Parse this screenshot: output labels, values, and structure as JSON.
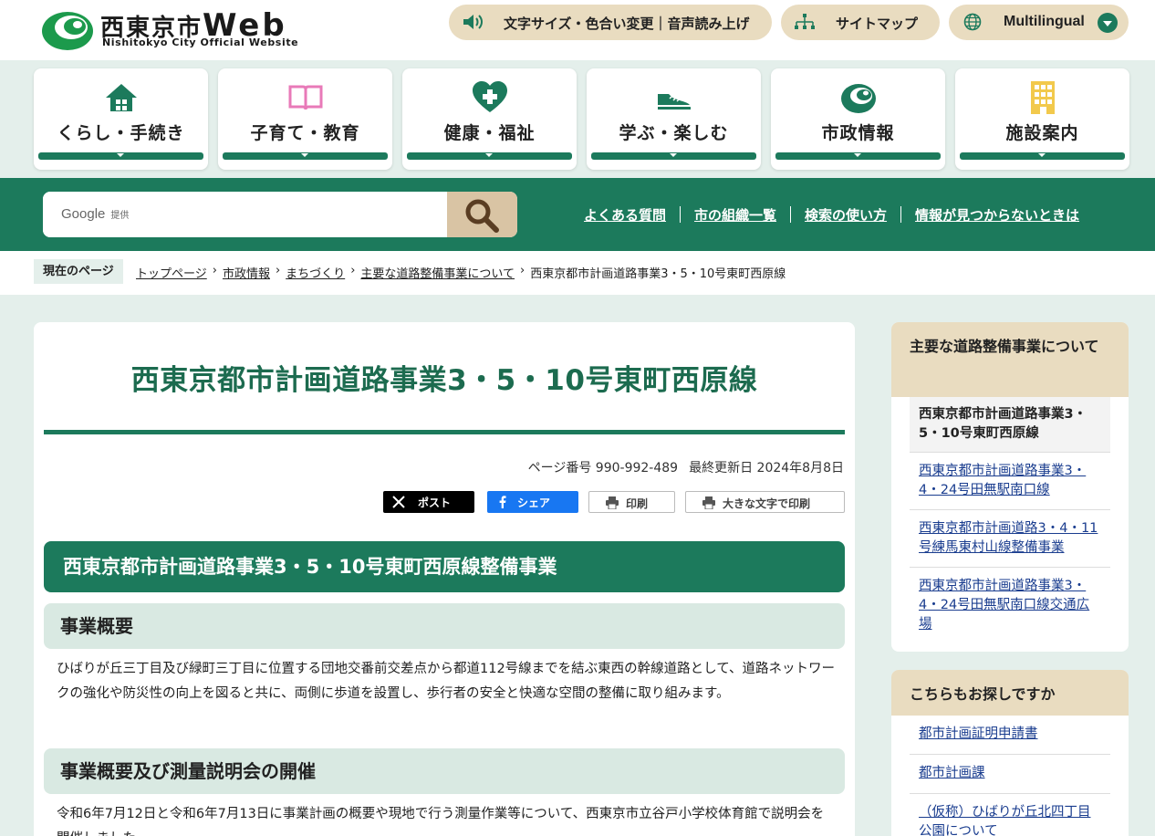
{
  "header": {
    "logo_title_ja": "西東京市",
    "logo_title_web": "Web",
    "logo_subtitle": "Nishitokyo City Official Website",
    "a11y_label": "文字サイズ・色合い変更｜音声読み上げ",
    "sitemap_label": "サイトマップ",
    "lang_label": "Multilingual"
  },
  "categories": [
    {
      "label": "くらし・手続き",
      "icon": "house-icon"
    },
    {
      "label": "子育て・教育",
      "icon": "open-book-icon"
    },
    {
      "label": "健康・福祉",
      "icon": "heart-cross-icon"
    },
    {
      "label": "学ぶ・楽しむ",
      "icon": "sneaker-icon"
    },
    {
      "label": "市政情報",
      "icon": "city-mark-icon"
    },
    {
      "label": "施設案内",
      "icon": "building-icon"
    }
  ],
  "search": {
    "google_label": "Google",
    "provided_label": "提供"
  },
  "quick_links": [
    "よくある質問",
    "市の組織一覧",
    "検索の使い方",
    "情報が見つからないときは"
  ],
  "breadcrumb": {
    "label": "現在のページ",
    "items": [
      "トップページ",
      "市政情報",
      "まちづくり",
      "主要な道路整備事業について"
    ],
    "current": "西東京都市計画道路事業3・5・10号東町西原線"
  },
  "main": {
    "title": "西東京都市計画道路事業3・5・10号東町西原線",
    "page_number": "ページ番号 990-992-489",
    "updated": "最終更新日 2024年8月8日",
    "share": {
      "x_label": "ポスト",
      "fb_label": "シェア",
      "print_label": "印刷",
      "bigprint_label": "大きな文字で印刷"
    },
    "h2": "西東京都市計画道路事業3・5・10号東町西原線整備事業",
    "section1_heading": "事業概要",
    "section1_text": "ひばりが丘三丁目及び緑町三丁目に位置する団地交番前交差点から都道112号線までを結ぶ東西の幹線道路として、道路ネットワークの強化や防災性の向上を図ると共に、両側に歩道を設置し、歩行者の安全と快適な空間の整備に取り組みます。",
    "section2_heading": "事業概要及び測量説明会の開催",
    "section2_text": "令和6年7月12日と令和6年7月13日に事業計画の概要や現地で行う測量作業等について、西東京市立谷戸小学校体育館で説明会を開催しました。"
  },
  "sidebar": {
    "box1_title": "主要な道路整備事業について",
    "box1_current": "西東京都市計画道路事業3・5・10号東町西原線",
    "box1_links": [
      "西東京都市計画道路事業3・4・24号田無駅南口線",
      "西東京都市計画道路3・4・11号練馬東村山線整備事業",
      "西東京都市計画道路事業3・4・24号田無駅南口線交通広場"
    ],
    "box2_title": "こちらもお探しですか",
    "box2_links": [
      "都市計画証明申請書",
      "都市計画課",
      "（仮称）ひばりが丘北四丁目公園について"
    ]
  },
  "colors": {
    "brand_green": "#1c7a5c",
    "beige": "#e9dcc0",
    "bg_mint": "#e4efeb",
    "link_blue": "#1a3d8f"
  }
}
